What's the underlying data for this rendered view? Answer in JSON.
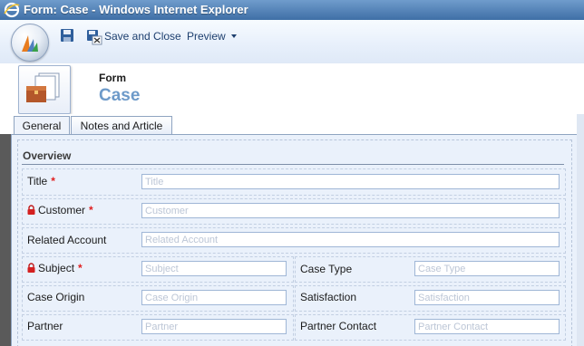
{
  "window": {
    "title": "Form: Case - Windows Internet Explorer"
  },
  "toolbar": {
    "save_and_close_label": "Save and Close",
    "preview_label": "Preview",
    "icons": [
      "ie-logo-icon",
      "crm-orb-icon",
      "save-icon",
      "save-close-icon",
      "chevron-down-icon"
    ]
  },
  "header": {
    "form_type": "Form",
    "entity_name": "Case"
  },
  "tabs": [
    {
      "label": "General"
    },
    {
      "label": "Notes and Article"
    }
  ],
  "section": {
    "title": "Overview"
  },
  "fields": {
    "title": {
      "label": "Title",
      "placeholder": "Title",
      "required": "*"
    },
    "customer": {
      "label": "Customer",
      "placeholder": "Customer",
      "required": "*"
    },
    "related_account": {
      "label": "Related Account",
      "placeholder": "Related Account"
    },
    "subject": {
      "label": "Subject",
      "placeholder": "Subject",
      "required": "*"
    },
    "case_type": {
      "label": "Case Type",
      "placeholder": "Case Type"
    },
    "case_origin": {
      "label": "Case Origin",
      "placeholder": "Case Origin"
    },
    "satisfaction": {
      "label": "Satisfaction",
      "placeholder": "Satisfaction"
    },
    "partner": {
      "label": "Partner",
      "placeholder": "Partner"
    },
    "partner_contact": {
      "label": "Partner Contact",
      "placeholder": "Partner Contact"
    }
  },
  "colors": {
    "title_bar": "#4f80b8",
    "required": "#e02020",
    "entity_name": "#6d9ac9",
    "form_body": "#eaf1fb"
  }
}
